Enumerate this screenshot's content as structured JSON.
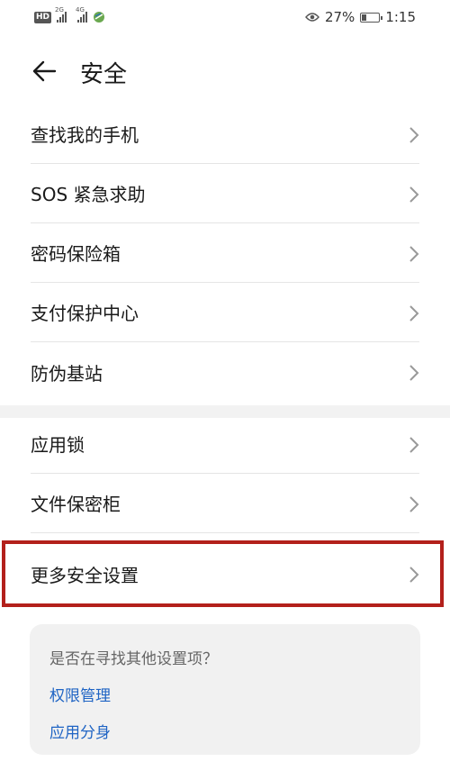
{
  "status_bar": {
    "hd_label": "HD",
    "sim1_tag": "2G",
    "sim2_tag": "4G",
    "battery_percent_text": "27%",
    "battery_level": 0.27,
    "time": "1:15"
  },
  "header": {
    "title": "安全"
  },
  "groups": [
    {
      "items": [
        {
          "label": "查找我的手机"
        },
        {
          "label": "SOS 紧急求助"
        },
        {
          "label": "密码保险箱"
        },
        {
          "label": "支付保护中心"
        },
        {
          "label": "防伪基站"
        }
      ]
    },
    {
      "items": [
        {
          "label": "应用锁"
        },
        {
          "label": "文件保密柜"
        },
        {
          "label": "更多安全设置"
        }
      ]
    }
  ],
  "suggestions": {
    "question": "是否在寻找其他设置项？",
    "links": [
      "权限管理",
      "应用分身"
    ]
  },
  "colors": {
    "accent_link": "#1f64c4",
    "highlight_border": "#b3201b"
  }
}
